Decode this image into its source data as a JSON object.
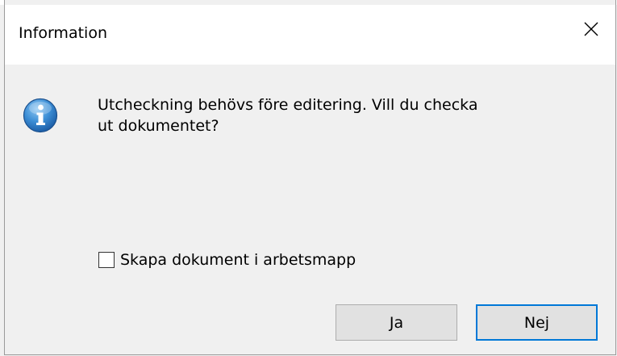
{
  "window": {
    "title": "Information",
    "close_icon": "close-icon"
  },
  "message": {
    "icon": "info-icon",
    "line1": "Utcheckning behövs före editering. Vill du checka",
    "line2": "ut dokumentet?"
  },
  "checkbox": {
    "label": "Skapa dokument i arbetsmapp",
    "checked": false
  },
  "buttons": {
    "yes_label": "Ja",
    "no_label": "Nej"
  },
  "colors": {
    "focus_border": "#0078d7",
    "button_bg": "#e1e1e1",
    "dialog_bg": "#f0f0f0"
  }
}
